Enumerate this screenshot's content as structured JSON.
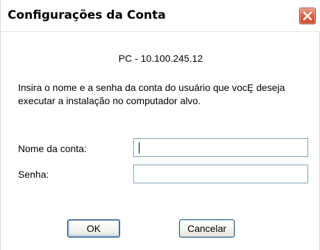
{
  "window": {
    "title": "Configurações da Conta"
  },
  "dialog": {
    "host": "PC - 10.100.245.12",
    "instructions": "Insira o nome e a senha da conta do usuário que vocȨ deseja executar a instalação no computador alvo."
  },
  "form": {
    "account_label": "Nome da conta:",
    "account_value": "",
    "password_label": "Senha:",
    "password_value": ""
  },
  "buttons": {
    "ok_label": "OK",
    "cancel_label": "Cancelar"
  },
  "icons": {
    "close": "close-icon"
  },
  "colors": {
    "close_button": "#d9644a",
    "input_border": "#7f9db9",
    "button_border": "#003c74"
  }
}
